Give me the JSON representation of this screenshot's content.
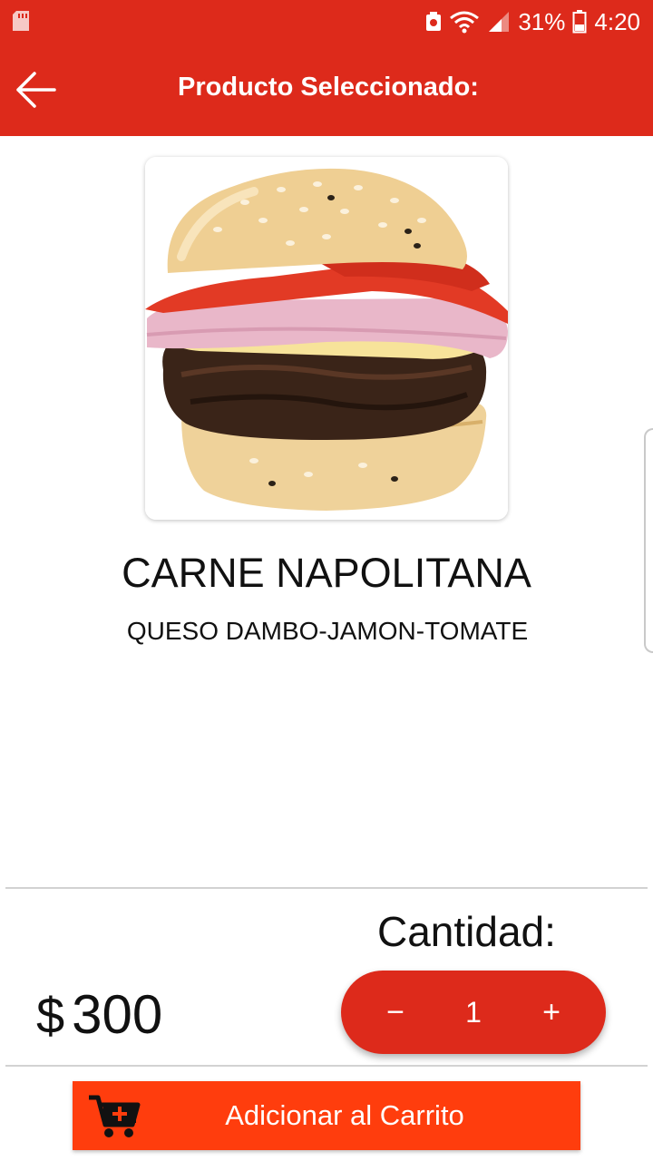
{
  "status_bar": {
    "battery_percent": "31%",
    "time": "4:20",
    "icons": [
      "sd-card-icon",
      "data-saver-icon",
      "wifi-icon",
      "signal-icon",
      "battery-icon"
    ]
  },
  "app_bar": {
    "title": "Producto Seleccionado:",
    "back_icon": "arrow-left-icon"
  },
  "product": {
    "image_icon": "burger-image",
    "name": "CARNE NAPOLITANA",
    "description": "QUESO DAMBO-JAMON-TOMATE",
    "currency_symbol": "$",
    "price": "300"
  },
  "quantity": {
    "label": "Cantidad:",
    "minus": "−",
    "value": "1",
    "plus": "+"
  },
  "add_to_cart": {
    "label": "Adicionar al Carrito",
    "icon": "add-to-cart-icon"
  },
  "colors": {
    "primary_red": "#dd2a1b",
    "button_orange": "#ff3d0d"
  }
}
